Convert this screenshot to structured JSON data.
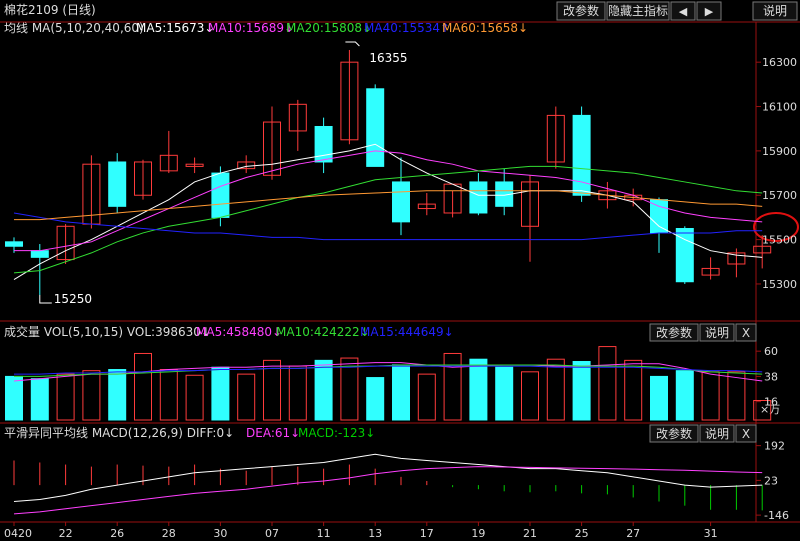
{
  "app": {
    "title": "棉花2109 (日线)",
    "buttons": {
      "params": "改参数",
      "hide_main": "隐藏主指标",
      "prev": "◀",
      "next": "▶",
      "help": "说明",
      "close": "X"
    }
  },
  "colors": {
    "bg": "#000000",
    "axis": "#9a1010",
    "up": "#ff3b3b",
    "down": "#30ffff",
    "ma5": "#ffffff",
    "ma10": "#ff40ff",
    "ma20": "#33dd33",
    "ma40": "#2222ff",
    "ma60": "#ff9933",
    "text": "#dddddd",
    "dea": "#ff40ff",
    "dif": "#ffffff",
    "macd_neg": "#00cc00"
  },
  "chart_data": [
    {
      "type": "candlestick",
      "title": "均线 MA(5,10,20,40,60)",
      "legend": [
        {
          "label": "MA5:15673↓",
          "color_key": "ma5"
        },
        {
          "label": "MA10:15689↓",
          "color_key": "ma10"
        },
        {
          "label": "MA20:15808↓",
          "color_key": "ma20"
        },
        {
          "label": "MA40:15534↑",
          "color_key": "ma40"
        },
        {
          "label": "MA60:15658↓",
          "color_key": "ma60"
        }
      ],
      "ylim": [
        15160,
        16400
      ],
      "yticks": [
        16300,
        16100,
        15900,
        15700,
        15500,
        15300
      ],
      "highlight_tick": 15500,
      "annotations": [
        {
          "label": "16355",
          "bar": 13,
          "value": 16355
        },
        {
          "label": "15250",
          "bar": 1,
          "value": 15250
        }
      ],
      "candles": [
        {
          "o": 15490,
          "h": 15510,
          "l": 15440,
          "c": 15470
        },
        {
          "o": 15450,
          "h": 15480,
          "l": 15250,
          "c": 15420
        },
        {
          "o": 15410,
          "h": 15570,
          "l": 15390,
          "c": 15560
        },
        {
          "o": 15570,
          "h": 15880,
          "l": 15550,
          "c": 15840
        },
        {
          "o": 15850,
          "h": 15890,
          "l": 15620,
          "c": 15650
        },
        {
          "o": 15700,
          "h": 15860,
          "l": 15680,
          "c": 15850
        },
        {
          "o": 15810,
          "h": 15990,
          "l": 15800,
          "c": 15880
        },
        {
          "o": 15830,
          "h": 15870,
          "l": 15800,
          "c": 15840
        },
        {
          "o": 15800,
          "h": 15830,
          "l": 15560,
          "c": 15600
        },
        {
          "o": 15820,
          "h": 15880,
          "l": 15800,
          "c": 15850
        },
        {
          "o": 15790,
          "h": 16100,
          "l": 15770,
          "c": 16030
        },
        {
          "o": 15990,
          "h": 16130,
          "l": 15900,
          "c": 16110
        },
        {
          "o": 16010,
          "h": 16050,
          "l": 15800,
          "c": 15850
        },
        {
          "o": 15950,
          "h": 16355,
          "l": 15930,
          "c": 16300
        },
        {
          "o": 16180,
          "h": 16200,
          "l": 15890,
          "c": 15830
        },
        {
          "o": 15760,
          "h": 15870,
          "l": 15520,
          "c": 15580
        },
        {
          "o": 15640,
          "h": 15710,
          "l": 15610,
          "c": 15660
        },
        {
          "o": 15620,
          "h": 15720,
          "l": 15600,
          "c": 15750
        },
        {
          "o": 15760,
          "h": 15800,
          "l": 15610,
          "c": 15620
        },
        {
          "o": 15760,
          "h": 15820,
          "l": 15610,
          "c": 15650
        },
        {
          "o": 15560,
          "h": 15790,
          "l": 15400,
          "c": 15760
        },
        {
          "o": 15850,
          "h": 16100,
          "l": 15820,
          "c": 16060
        },
        {
          "o": 16060,
          "h": 16100,
          "l": 15670,
          "c": 15700
        },
        {
          "o": 15680,
          "h": 15760,
          "l": 15640,
          "c": 15720
        },
        {
          "o": 15680,
          "h": 15730,
          "l": 15650,
          "c": 15700
        },
        {
          "o": 15680,
          "h": 15690,
          "l": 15440,
          "c": 15530
        },
        {
          "o": 15550,
          "h": 15560,
          "l": 15300,
          "c": 15310
        },
        {
          "o": 15340,
          "h": 15420,
          "l": 15320,
          "c": 15370
        },
        {
          "o": 15390,
          "h": 15460,
          "l": 15330,
          "c": 15440
        },
        {
          "o": 15440,
          "h": 15520,
          "l": 15370,
          "c": 15470
        }
      ],
      "ma": {
        "ma5": [
          15320,
          15390,
          15450,
          15500,
          15560,
          15620,
          15680,
          15760,
          15800,
          15830,
          15840,
          15860,
          15880,
          15900,
          15930,
          15860,
          15800,
          15750,
          15700,
          15700,
          15720,
          15720,
          15720,
          15700,
          15670,
          15560,
          15500,
          15450,
          15430,
          15420
        ],
        "ma10": [
          15450,
          15450,
          15470,
          15490,
          15540,
          15590,
          15640,
          15690,
          15740,
          15780,
          15810,
          15840,
          15860,
          15880,
          15900,
          15890,
          15860,
          15840,
          15810,
          15800,
          15790,
          15780,
          15760,
          15730,
          15700,
          15650,
          15620,
          15600,
          15590,
          15580
        ],
        "ma20": [
          15350,
          15360,
          15400,
          15440,
          15490,
          15530,
          15560,
          15580,
          15600,
          15630,
          15660,
          15690,
          15710,
          15740,
          15770,
          15780,
          15790,
          15800,
          15810,
          15820,
          15830,
          15830,
          15820,
          15810,
          15800,
          15780,
          15760,
          15740,
          15720,
          15710
        ],
        "ma40": [
          15620,
          15600,
          15580,
          15570,
          15560,
          15550,
          15540,
          15530,
          15530,
          15520,
          15510,
          15510,
          15500,
          15500,
          15500,
          15500,
          15500,
          15500,
          15500,
          15500,
          15500,
          15500,
          15500,
          15510,
          15520,
          15530,
          15530,
          15530,
          15540,
          15540
        ],
        "ma60": [
          15590,
          15590,
          15600,
          15610,
          15620,
          15630,
          15640,
          15650,
          15660,
          15670,
          15680,
          15690,
          15700,
          15705,
          15710,
          15715,
          15720,
          15720,
          15720,
          15720,
          15720,
          15720,
          15710,
          15700,
          15690,
          15680,
          15670,
          15660,
          15660,
          15650
        ]
      }
    },
    {
      "type": "bar",
      "title": "成交量 VOL(5,10,15) VOL:398630↓",
      "legend": [
        {
          "label": "MA5:458480↓",
          "color_key": "ma10"
        },
        {
          "label": "MA10:424222↓",
          "color_key": "ma20"
        },
        {
          "label": "MA15:444649↓",
          "color_key": "ma40"
        }
      ],
      "yticks": [
        "60",
        "38",
        "16"
      ],
      "unit_label": "×万",
      "ylim": [
        0,
        68
      ],
      "values": [
        38,
        36,
        40,
        43,
        44,
        58,
        44,
        39,
        46,
        40,
        52,
        47,
        52,
        54,
        37,
        48,
        40,
        58,
        53,
        46,
        42,
        53,
        51,
        64,
        52,
        38,
        43,
        42,
        42,
        17
      ],
      "ma": {
        "ma5": [
          34,
          36,
          38,
          40,
          40,
          42,
          44,
          45,
          46,
          46,
          47,
          47,
          48,
          49,
          50,
          50,
          48,
          46,
          47,
          48,
          48,
          47,
          47,
          48,
          49,
          49,
          45,
          40,
          37,
          34
        ],
        "ma10": [
          38,
          38,
          39,
          40,
          40,
          41,
          42,
          43,
          44,
          44,
          45,
          45,
          46,
          47,
          47,
          48,
          48,
          48,
          48,
          48,
          48,
          48,
          47,
          47,
          47,
          46,
          44,
          42,
          41,
          40
        ],
        "ma15": [
          40,
          40,
          41,
          41,
          42,
          42,
          43,
          43,
          44,
          44,
          45,
          45,
          46,
          46,
          47,
          47,
          47,
          47,
          47,
          47,
          47,
          46,
          46,
          46,
          46,
          45,
          44,
          43,
          43,
          42
        ]
      }
    },
    {
      "type": "bar",
      "title": "平滑异同平均线 MACD(12,26,9) DIFF:0↓",
      "legend": [
        {
          "label": "DEA:61↓",
          "color_key": "dea"
        },
        {
          "label": "MACD:-123↓",
          "color_key": "macd_neg"
        }
      ],
      "yticks": [
        "192",
        "23",
        "-146"
      ],
      "ylim": [
        -160,
        200
      ],
      "values": [
        120,
        110,
        100,
        90,
        100,
        95,
        90,
        100,
        80,
        70,
        90,
        90,
        80,
        100,
        80,
        40,
        20,
        -10,
        -20,
        -30,
        -35,
        -30,
        -40,
        -45,
        -60,
        -80,
        -100,
        -120,
        -120,
        -123
      ],
      "dif": [
        -80,
        -70,
        -50,
        -20,
        0,
        20,
        40,
        60,
        70,
        80,
        90,
        100,
        110,
        130,
        150,
        130,
        120,
        110,
        100,
        90,
        80,
        80,
        70,
        60,
        40,
        20,
        0,
        -10,
        -5,
        0
      ],
      "dea": [
        -140,
        -130,
        -115,
        -100,
        -85,
        -70,
        -55,
        -40,
        -30,
        -20,
        -5,
        10,
        20,
        35,
        55,
        70,
        80,
        85,
        90,
        88,
        86,
        84,
        82,
        80,
        78,
        75,
        72,
        68,
        64,
        61
      ]
    }
  ],
  "x_labels": [
    "0420",
    "22",
    "26",
    "28",
    "30",
    "07",
    "11",
    "13",
    "17",
    "19",
    "21",
    "25",
    "27",
    "31"
  ],
  "x_label_bars": [
    0,
    2,
    4,
    6,
    8,
    10,
    12,
    14,
    16,
    18,
    20,
    22,
    24,
    27
  ]
}
